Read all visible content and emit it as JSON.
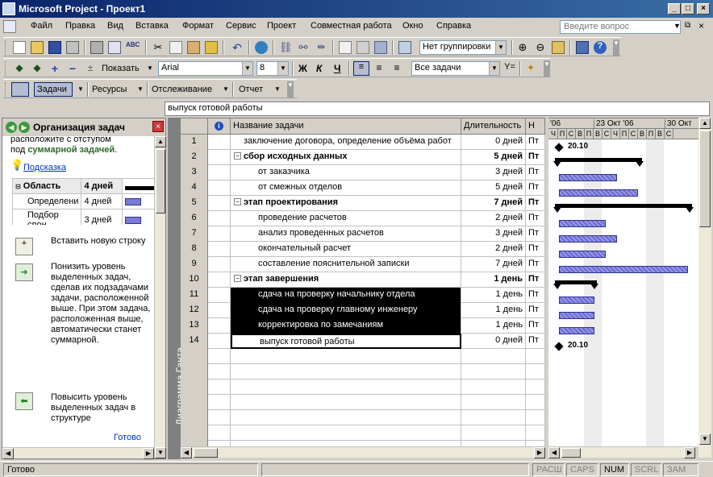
{
  "window": {
    "title": "Microsoft Project - Проект1",
    "question_placeholder": "Введите вопрос"
  },
  "menu": [
    "Файл",
    "Правка",
    "Вид",
    "Вставка",
    "Формат",
    "Сервис",
    "Проект",
    "Совместная работа",
    "Окно",
    "Справка"
  ],
  "toolbar1": {
    "grouping": "Нет группировки"
  },
  "toolbar2": {
    "show_label": "Показать",
    "font": "Arial",
    "font_size": "8",
    "bold": "Ж",
    "italic": "К",
    "underline": "Ч",
    "filter": "Все задачи"
  },
  "toolbar3": {
    "tasks": "Задачи",
    "resources": "Ресурсы",
    "tracking": "Отслеживание",
    "report": "Отчет"
  },
  "entry_value": "выпуск готовой работы",
  "pane": {
    "title": "Организация задач",
    "intro_line1": "расположите с отступом",
    "intro_line2_a": "под ",
    "intro_line2_b": "суммарной задачей",
    "intro_line2_c": ".",
    "hint": "Подсказка",
    "mini_header_name": "Область",
    "mini_header_dur": "4 дней",
    "mini_rows": [
      {
        "name": "Определени",
        "dur": "4 дней"
      },
      {
        "name": "Подбор спон",
        "dur": "3 дней"
      }
    ],
    "action1": "Вставить новую строку",
    "action2": "Понизить уровень выделенных задач, сделав их подзадачами задачи, расположенной выше. При этом задача, расположенная выше, автоматически станет суммарной.",
    "action3": "Повысить уровень выделенных задач в структуре",
    "done": "Готово"
  },
  "view_label": "Диаграмма Ганта",
  "grid": {
    "col_info": "i",
    "col_name": "Название задачи",
    "col_duration": "Длительность",
    "col_start": "Н",
    "rows": [
      {
        "num": "1",
        "name": "заключение договора, определение объёма работ",
        "dur": "0 дней",
        "start": "Пт"
      },
      {
        "num": "2",
        "name": "сбор исходных данных",
        "dur": "5 дней",
        "start": "Пт"
      },
      {
        "num": "3",
        "name": "от заказчика",
        "dur": "3 дней",
        "start": "Пт"
      },
      {
        "num": "4",
        "name": "от смежных отделов",
        "dur": "5 дней",
        "start": "Пт"
      },
      {
        "num": "5",
        "name": "этап проектирования",
        "dur": "7 дней",
        "start": "Пт"
      },
      {
        "num": "6",
        "name": "проведение расчетов",
        "dur": "2 дней",
        "start": "Пт"
      },
      {
        "num": "7",
        "name": "анализ проведенных расчетов",
        "dur": "3 дней",
        "start": "Пт"
      },
      {
        "num": "8",
        "name": "окончательный расчет",
        "dur": "2 дней",
        "start": "Пт"
      },
      {
        "num": "9",
        "name": "составление пояснительной записки",
        "dur": "7 дней",
        "start": "Пт"
      },
      {
        "num": "10",
        "name": "этап завершения",
        "dur": "1 день",
        "start": "Пт"
      },
      {
        "num": "11",
        "name": "сдача на проверку начальнику отдела",
        "dur": "1 день",
        "start": "Пт"
      },
      {
        "num": "12",
        "name": "сдача на проверку главному инженеру",
        "dur": "1 день",
        "start": "Пт"
      },
      {
        "num": "13",
        "name": "корректировка по замечаниям",
        "dur": "1 день",
        "start": "Пт"
      },
      {
        "num": "14",
        "name": "выпуск готовой работы",
        "dur": "0 дней",
        "start": "Пт"
      }
    ]
  },
  "gantt": {
    "weeks": [
      "'06",
      "23 Окт '06",
      "30 Окт"
    ],
    "days": [
      "Ч",
      "П",
      "С",
      "В",
      "П",
      "В",
      "С",
      "Ч",
      "П",
      "С",
      "В",
      "П",
      "В",
      "С"
    ],
    "milestone1": "20.10",
    "milestone2": "20.10"
  },
  "status": {
    "ready": "Готово",
    "ext": "РАСШ",
    "caps": "CAPS",
    "num": "NUM",
    "scrl": "SCRL",
    "ovr": "ЗАМ"
  }
}
